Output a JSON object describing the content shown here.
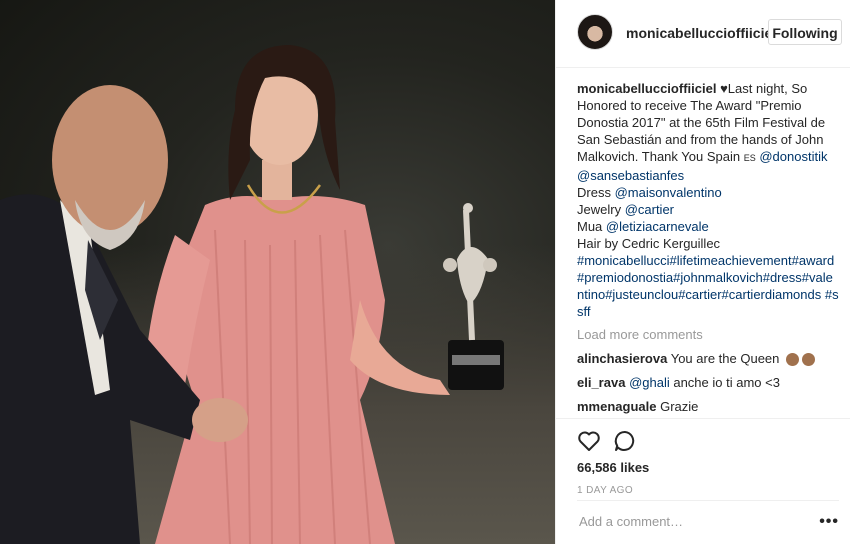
{
  "post": {
    "username": "monicabelluccioffiicie",
    "follow_label": "Following"
  },
  "caption": {
    "username": "monicabelluccioffiiciel",
    "heart": "♥",
    "text1": "Last night, So Honored to receive The Award \"Premio Donostia 2017\" at the 65th Film Festival de San Sebastián and from the hands of John Malkovich. Thank You Spain ",
    "flag": "ES",
    "mention1": "@donostitik",
    "mention2": "@sansebastianfes",
    "dress_label": "Dress ",
    "dress_mention": "@maisonvalentino",
    "jewelry_label": "Jewelry ",
    "jewelry_mention": "@cartier",
    "mua_label": "Mua ",
    "mua_mention": "@letiziacarnevale",
    "hair": "Hair by Cedric Kerguillec",
    "hashtags": "#monicabellucci#lifetimeachievement#award #premiodonostia#johnmalkovich#dress#valentino#justeunclou#cartier#cartierdiamonds #ssff"
  },
  "load_more": "Load more comments",
  "comments": [
    {
      "user": "alinchasierova",
      "text": "You are the Queen"
    },
    {
      "user": "eli_rava",
      "mention": "@ghali",
      "text": " anche io ti amo <3"
    },
    {
      "user": "mmenaguale",
      "text": "Grazie"
    }
  ],
  "actions": {
    "like_icon": "heart-outline-icon",
    "comment_icon": "speech-bubble-icon",
    "likes": "66,586 likes",
    "time": "1 DAY AGO"
  },
  "add_comment": {
    "placeholder": "Add a comment…",
    "more": "•••"
  },
  "colors": {
    "link": "#003569",
    "muted": "#999999",
    "dress": "#e08f8c"
  }
}
